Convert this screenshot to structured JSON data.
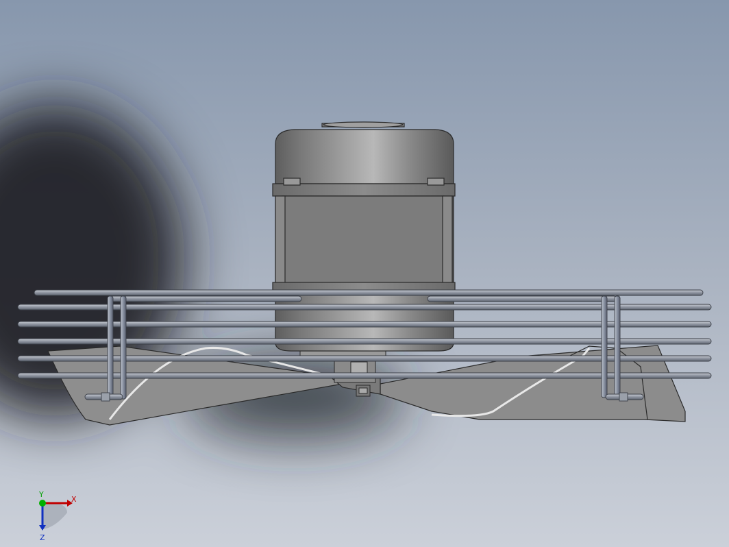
{
  "viewport": {
    "background_top": "#8a9bb0",
    "background_bottom": "#c9cfd8"
  },
  "model": {
    "motor_color": "#808080",
    "band_color": "#7a7a7a",
    "blade_color": "#8c8c8c",
    "guard_color": "#9aa0aa",
    "outline_color": "#2a2a2a"
  },
  "triad": {
    "x_label": "X",
    "y_label": "Y",
    "z_label": "Z",
    "x_color": "#c00000",
    "y_color": "#00a000",
    "z_color": "#1030c0"
  }
}
